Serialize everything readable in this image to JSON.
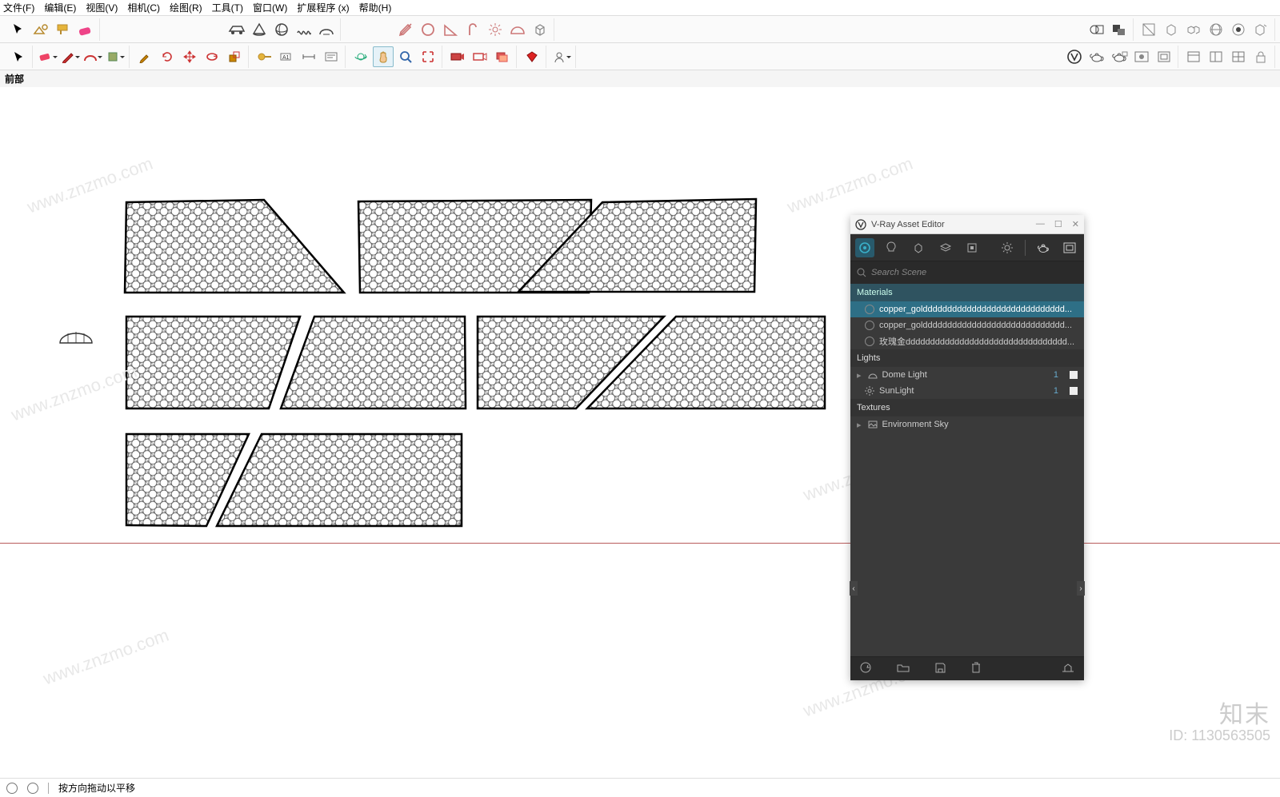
{
  "menu": {
    "items": [
      "文件(F)",
      "编辑(E)",
      "视图(V)",
      "相机(C)",
      "绘图(R)",
      "工具(T)",
      "窗口(W)",
      "扩展程序 (x)",
      "帮助(H)"
    ]
  },
  "viewport_label": "前部",
  "statusbar": {
    "hint": "按方向拖动以平移"
  },
  "watermark": {
    "brand": "知末",
    "id_label": "ID: 1130563505",
    "url": "www.znzmo.com"
  },
  "vray": {
    "title": "V-Ray Asset Editor",
    "search_placeholder": "Search Scene",
    "sections": {
      "materials": {
        "header": "Materials",
        "items": [
          {
            "name": "copper_golddddddddddddddddddddddddddddd..."
          },
          {
            "name": "copper_golddddddddddddddddddddddddddddd..."
          },
          {
            "name": "玫瑰金ddddddddddddddddddddddddddddddddd..."
          }
        ],
        "selected_index": 0
      },
      "lights": {
        "header": "Lights",
        "items": [
          {
            "name": "Dome Light",
            "count": "1"
          },
          {
            "name": "SunLight",
            "count": "1"
          }
        ]
      },
      "textures": {
        "header": "Textures",
        "items": [
          {
            "name": "Environment Sky"
          }
        ]
      }
    }
  },
  "toolbar1_icons": [
    "select",
    "components",
    "paint",
    "erase"
  ],
  "toolbar1b_icons": [
    "car",
    "cone",
    "ball",
    "spring",
    "arc"
  ],
  "toolbar1c_icons": [
    "trowel",
    "circle",
    "wedge",
    "cane",
    "sun",
    "dome",
    "cube"
  ],
  "toolbar1d_icons": [
    "gear-ring",
    "group-sel",
    "frame",
    "box3d",
    "boxes",
    "globe",
    "target",
    "batch"
  ],
  "toolbar2a_icons": [
    "arrow",
    "eraser",
    "pencil",
    "arc2",
    "paint2",
    "paste",
    "spin",
    "rotate-left",
    "arrows-cross",
    "rotate",
    "crop",
    "tape",
    "tag",
    "dim",
    "text",
    "walk",
    "hand",
    "zoom",
    "target2",
    "cam-a",
    "cam-b",
    "slides",
    "ruby",
    "user"
  ],
  "toolbar2b_icons": [
    "vlogo",
    "teapot-a",
    "teapot-b",
    "mat-preview",
    "frame-v",
    "pane-a",
    "pane-b",
    "pane-c",
    "lock"
  ]
}
